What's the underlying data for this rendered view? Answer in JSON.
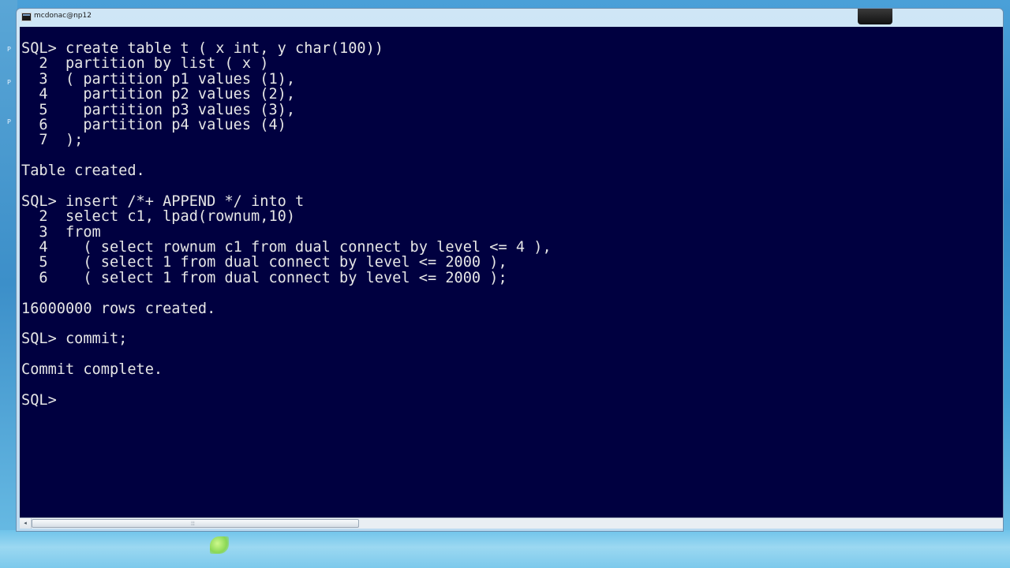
{
  "window": {
    "title": "mcdonac@np12"
  },
  "console": {
    "lines": [
      "SQL> create table t ( x int, y char(100))",
      "  2  partition by list ( x )",
      "  3  ( partition p1 values (1),",
      "  4    partition p2 values (2),",
      "  5    partition p3 values (3),",
      "  6    partition p4 values (4)",
      "  7  );",
      "",
      "Table created.",
      "",
      "SQL> insert /*+ APPEND */ into t",
      "  2  select c1, lpad(rownum,10)",
      "  3  from",
      "  4    ( select rownum c1 from dual connect by level <= 4 ),",
      "  5    ( select 1 from dual connect by level <= 2000 ),",
      "  6    ( select 1 from dual connect by level <= 2000 );",
      "",
      "16000000 rows created.",
      "",
      "SQL> commit;",
      "",
      "Commit complete.",
      "",
      "SQL> "
    ]
  },
  "colors": {
    "console_background": "#000040",
    "console_text": "#e6e6e6"
  },
  "icons": {
    "window_icon": "console-window-icon",
    "scroll_left": "chevron-left-icon",
    "scroll_grip": "grip-icon"
  },
  "scrollbar": {
    "left_arrow": "◂",
    "grip": "⦙⦙⦙"
  },
  "desktop": {
    "glyphs": [
      "P",
      "P",
      "P"
    ]
  }
}
